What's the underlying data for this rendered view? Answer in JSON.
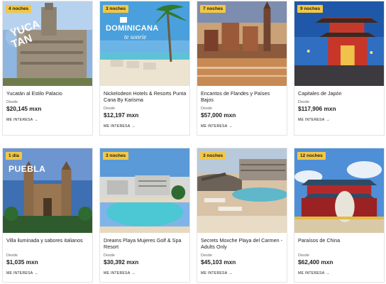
{
  "cards": [
    {
      "badge": "4 noches",
      "title": "Yucatán al Estilo Palacio",
      "desde": "Desde",
      "price": "$20,145 mxn",
      "more": "ME INTERESA",
      "img_text": [
        "YUCA",
        "TAN"
      ]
    },
    {
      "badge": "3 noches",
      "title": "Nickelodeon Hotels & Resorts Punta Cana By Karisma",
      "desde": "Desde",
      "price": "$12,197 mxn",
      "more": "ME INTERESA",
      "img_text": [
        "DOMINICANA",
        "te sonríe"
      ]
    },
    {
      "badge": "7 noches",
      "title": "Encantos de Flandes y Países Bajos",
      "desde": "Desde",
      "price": "$57,000 mxn",
      "more": "ME INTERESA"
    },
    {
      "badge": "9 noches",
      "title": "Capitales de Japón",
      "desde": "Desde",
      "price": "$117,906 mxn",
      "more": "ME INTERESA"
    },
    {
      "badge": "1 día",
      "title": "Villa iluminada y sabores italianos",
      "desde": "Desde",
      "price": "$1,035 mxn",
      "more": "ME INTERESA",
      "img_text": [
        "PUEBLA"
      ]
    },
    {
      "badge": "3 noches",
      "title": "Dreams Playa Mujeres Golf & Spa Resort",
      "desde": "Desde",
      "price": "$30,392 mxn",
      "more": "ME INTERESA"
    },
    {
      "badge": "3 noches",
      "title": "Secrets Moxche Playa del Carmen - Adults Only",
      "desde": "Desde",
      "price": "$45,103 mxn",
      "more": "ME INTERESA"
    },
    {
      "badge": "12 noches",
      "title": "Paraísos de China",
      "desde": "Desde",
      "price": "$62,400 mxn",
      "more": "ME INTERESA"
    }
  ],
  "arrow": "→"
}
